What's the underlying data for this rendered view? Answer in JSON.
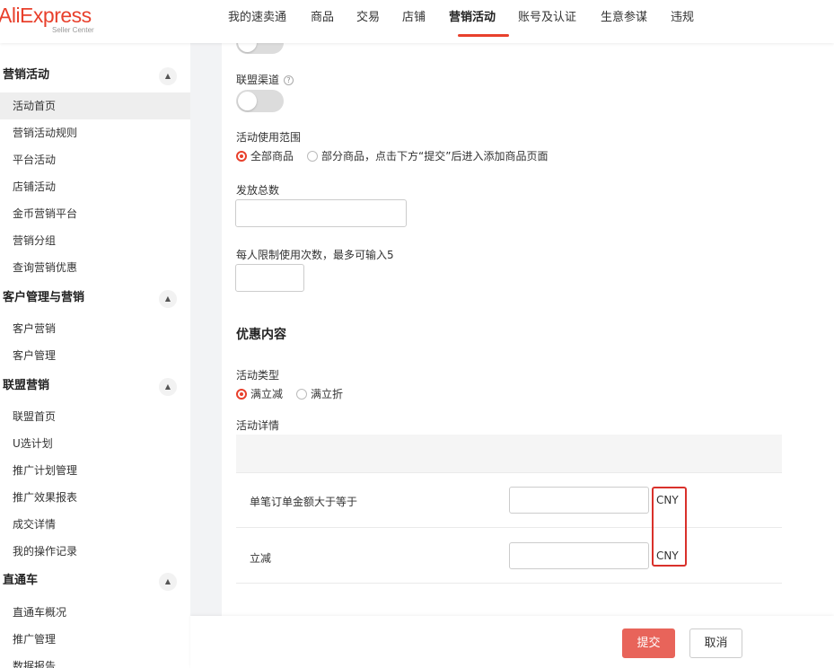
{
  "brand": {
    "name": "AliExpress",
    "sub": "Seller Center"
  },
  "nav": [
    {
      "label": "我的速卖通"
    },
    {
      "label": "商品"
    },
    {
      "label": "交易"
    },
    {
      "label": "店铺"
    },
    {
      "label": "营销活动",
      "active": true
    },
    {
      "label": "账号及认证"
    },
    {
      "label": "生意参谋"
    },
    {
      "label": "违规"
    }
  ],
  "sidebar": {
    "groups": [
      {
        "title": "营销活动",
        "items": [
          "活动首页",
          "营销活动规则",
          "平台活动",
          "店铺活动",
          "金币营销平台",
          "营销分组",
          "查询营销优惠"
        ]
      },
      {
        "title": "客户管理与营销",
        "items": [
          "客户营销",
          "客户管理"
        ]
      },
      {
        "title": "联盟营销",
        "items": [
          "联盟首页",
          "U选计划",
          "推广计划管理",
          "推广效果报表",
          "成交详情",
          "我的操作记录"
        ]
      },
      {
        "title": "直通车",
        "items": [
          "直通车概况",
          "推广管理",
          "数据报告"
        ]
      }
    ],
    "active_item": "活动首页",
    "collapse_icon": "chevron-up-icon"
  },
  "form": {
    "alliance_channel_label": "联盟渠道",
    "help_icon": "?",
    "scope_label": "活动使用范围",
    "scope_options": [
      "全部商品",
      "部分商品，点击下方“提交”后进入添加商品页面"
    ],
    "scope_selected": "全部商品",
    "total_label": "发放总数",
    "total_value": "",
    "limit_label": "每人限制使用次数，最多可输入5",
    "limit_value": "",
    "discount_section_title": "优惠内容",
    "type_label": "活动类型",
    "type_options": [
      "满立减",
      "满立折"
    ],
    "type_selected": "满立减",
    "details_label": "活动详情",
    "rows": [
      {
        "label": "单笔订单金额大于等于",
        "value": "",
        "unit": "CNY"
      },
      {
        "label": "立减",
        "value": "",
        "unit": "CNY"
      }
    ]
  },
  "actions": {
    "submit": "提交",
    "cancel": "取消"
  },
  "colors": {
    "accent": "#e8402c",
    "submit_bg": "#e8645a",
    "highlight": "#d9312b",
    "sidebar_active": "#eeeeee"
  }
}
